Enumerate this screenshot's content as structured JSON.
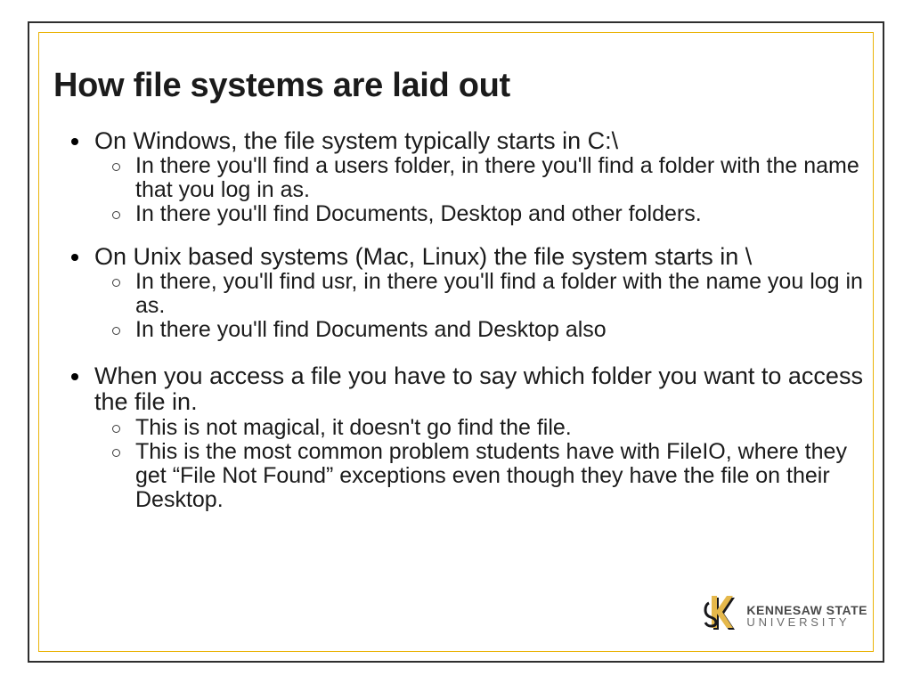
{
  "title": "How file systems are laid out",
  "bullets": {
    "b1": {
      "main": "On Windows, the file system typically starts in C:\\",
      "sub1": "In there you'll find a users folder, in there you'll find a folder with the name that you log in as.",
      "sub2": "In there you'll find Documents, Desktop and other folders."
    },
    "b2": {
      "main": "On Unix based systems (Mac, Linux) the file system starts in \\",
      "sub1": "In there, you'll find usr, in there you'll find a folder with the name you log in as.",
      "sub2": "In there you'll find Documents and Desktop also"
    },
    "b3": {
      "main": "When you access a file you have to say which folder you want to access the file in.",
      "sub1": "This is not magical, it doesn't go find the file.",
      "sub2": "This is the most common problem students have with FileIO, where they get “File Not Found” exceptions even though they have the file on their Desktop."
    }
  },
  "logo": {
    "line1": "KENNESAW STATE",
    "line2": "UNIVERSITY",
    "colors": {
      "gold": "#e5b84b",
      "black": "#18181b"
    }
  }
}
